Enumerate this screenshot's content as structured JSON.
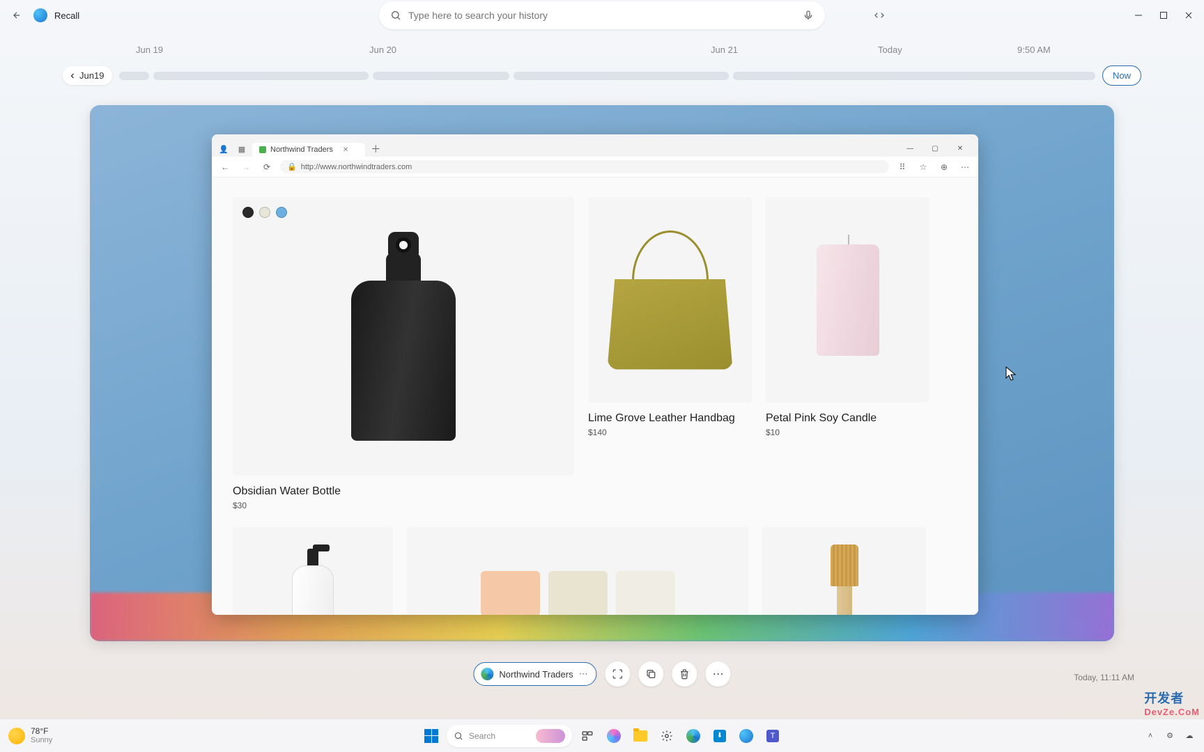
{
  "app": {
    "title": "Recall"
  },
  "search": {
    "placeholder": "Type here to search your history"
  },
  "timeline": {
    "labels": [
      "Jun 19",
      "Jun 20",
      "Jun 21",
      "Today",
      "9:50 AM"
    ],
    "back_pill": "Jun19",
    "now": "Now"
  },
  "browser": {
    "tab_title": "Northwind Traders",
    "url": "http://www.northwindtraders.com"
  },
  "products": [
    {
      "name": "Obsidian  Water Bottle",
      "price": "$30"
    },
    {
      "name": "Lime Grove Leather Handbag",
      "price": "$140"
    },
    {
      "name": "Petal Pink Soy Candle",
      "price": "$10"
    }
  ],
  "color_swatches": [
    "#2a2a2a",
    "#e8e6d8",
    "#6bb0e0"
  ],
  "actionbar": {
    "app_pill": "Northwind Traders"
  },
  "timestamp": "Today, 11:11 AM",
  "taskbar": {
    "temp": "78°F",
    "condition": "Sunny",
    "search_placeholder": "Search"
  },
  "watermark": {
    "line1": "开发者",
    "line2": "DevZe.CoM"
  }
}
